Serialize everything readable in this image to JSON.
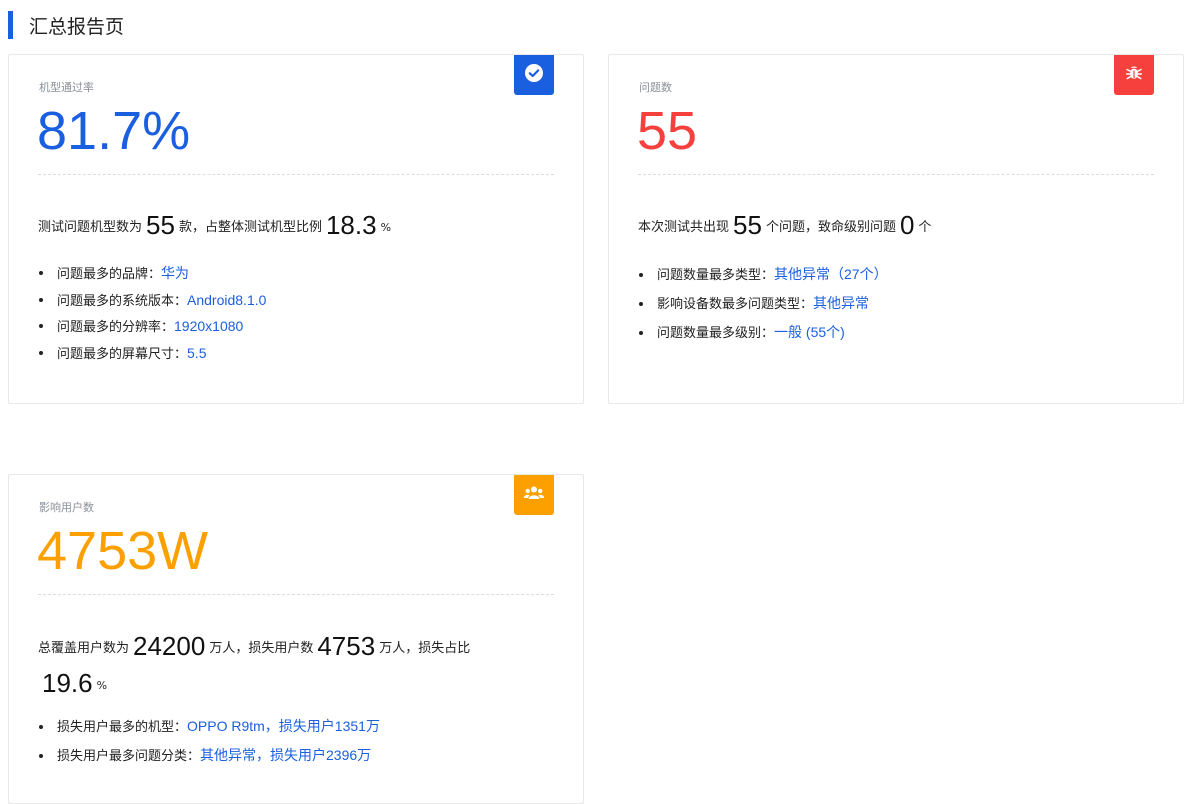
{
  "page": {
    "title": "汇总报告页"
  },
  "colors": {
    "blue": "#1a5fe0",
    "red": "#f5403e",
    "orange": "#fca000"
  },
  "cards": {
    "pass_rate": {
      "icon": "check-circle-icon",
      "label": "机型通过率",
      "value": "81.7%",
      "summary": {
        "text1": "测试问题机型数为",
        "num1": "55",
        "text2": "款，占整体测试机型比例",
        "num2": "18.3",
        "unit2": "%"
      },
      "details": [
        {
          "label": "问题最多的品牌：",
          "value": "华为"
        },
        {
          "label": "问题最多的系统版本：",
          "value": "Android8.1.0"
        },
        {
          "label": "问题最多的分辨率：",
          "value": "1920x1080"
        },
        {
          "label": "问题最多的屏幕尺寸：",
          "value": "5.5"
        }
      ]
    },
    "issues": {
      "icon": "bug-icon",
      "label": "问题数",
      "value": "55",
      "summary": {
        "text1": "本次测试共出现",
        "num1": "55",
        "text2": "个问题，致命级别问题",
        "num2": "0",
        "unit2": "个"
      },
      "details": [
        {
          "label": "问题数量最多类型：",
          "value": "其他异常（27个）"
        },
        {
          "label": "影响设备数最多问题类型：",
          "value": "其他异常"
        },
        {
          "label": "问题数量最多级别：",
          "value": "一般 (55个)"
        }
      ]
    },
    "users": {
      "icon": "users-icon",
      "label": "影响用户数",
      "value": "4753W",
      "summary": {
        "text1": "总覆盖用户数为",
        "num1": "24200",
        "text2": "万人，损失用户数",
        "num2": "4753",
        "text3": "万人，损失占比",
        "num3": "19.6",
        "unit3": "%"
      },
      "details": [
        {
          "label": "损失用户最多的机型：",
          "value": "OPPO R9tm，损失用户1351万"
        },
        {
          "label": "损失用户最多问题分类：",
          "value": "其他异常，损失用户2396万"
        }
      ]
    }
  }
}
